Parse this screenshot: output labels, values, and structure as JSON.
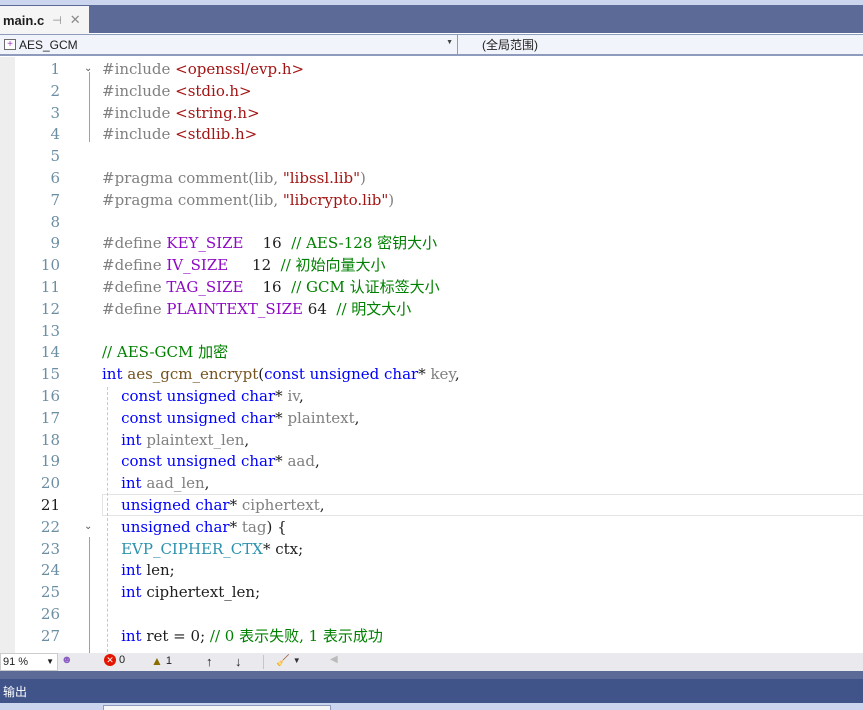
{
  "tab": {
    "title": "main.c",
    "pin_icon": "pin-icon",
    "close_icon": "close-icon"
  },
  "navbar": {
    "scope_left": "AES_GCM",
    "scope_right": "(全局范围)"
  },
  "editor": {
    "current_line": 21,
    "lines": [
      {
        "n": "1",
        "tokens": [
          [
            "k-pre",
            "#include "
          ],
          [
            "k-inc",
            "<openssl/evp.h>"
          ]
        ]
      },
      {
        "n": "2",
        "tokens": [
          [
            "k-pre",
            "#include "
          ],
          [
            "k-inc",
            "<stdio.h>"
          ]
        ]
      },
      {
        "n": "3",
        "tokens": [
          [
            "k-pre",
            "#include "
          ],
          [
            "k-inc",
            "<string.h>"
          ]
        ]
      },
      {
        "n": "4",
        "tokens": [
          [
            "k-pre",
            "#include "
          ],
          [
            "k-inc",
            "<stdlib.h>"
          ]
        ]
      },
      {
        "n": "5",
        "tokens": []
      },
      {
        "n": "6",
        "tokens": [
          [
            "k-pre",
            "#pragma comment(lib, "
          ],
          [
            "k-inc",
            "\"libssl.lib\""
          ],
          [
            "k-pre",
            ")"
          ]
        ]
      },
      {
        "n": "7",
        "tokens": [
          [
            "k-pre",
            "#pragma comment(lib, "
          ],
          [
            "k-inc",
            "\"libcrypto.lib\""
          ],
          [
            "k-pre",
            ")"
          ]
        ]
      },
      {
        "n": "8",
        "tokens": []
      },
      {
        "n": "9",
        "tokens": [
          [
            "k-pre",
            "#define "
          ],
          [
            "k-mac",
            "KEY_SIZE"
          ],
          [
            "k-num",
            "    16  "
          ],
          [
            "k-cmt",
            "// AES-128 密钥大小"
          ]
        ]
      },
      {
        "n": "10",
        "tokens": [
          [
            "k-pre",
            "#define "
          ],
          [
            "k-mac",
            "IV_SIZE"
          ],
          [
            "k-num",
            "     12  "
          ],
          [
            "k-cmt",
            "// 初始向量大小"
          ]
        ]
      },
      {
        "n": "11",
        "tokens": [
          [
            "k-pre",
            "#define "
          ],
          [
            "k-mac",
            "TAG_SIZE"
          ],
          [
            "k-num",
            "    16  "
          ],
          [
            "k-cmt",
            "// GCM 认证标签大小"
          ]
        ]
      },
      {
        "n": "12",
        "tokens": [
          [
            "k-pre",
            "#define "
          ],
          [
            "k-mac",
            "PLAINTEXT_SIZE"
          ],
          [
            "k-num",
            " 64  "
          ],
          [
            "k-cmt",
            "// 明文大小"
          ]
        ]
      },
      {
        "n": "13",
        "tokens": []
      },
      {
        "n": "14",
        "tokens": [
          [
            "k-cmt",
            "// AES-GCM 加密"
          ]
        ]
      },
      {
        "n": "15",
        "tokens": [
          [
            "k-key",
            "int "
          ],
          [
            "k-fn",
            "aes_gcm_encrypt"
          ],
          [
            "k-txt",
            "("
          ],
          [
            "k-key",
            "const unsigned char"
          ],
          [
            "k-txt",
            "* "
          ],
          [
            "k-par",
            "key"
          ],
          [
            "k-txt",
            ","
          ]
        ]
      },
      {
        "n": "16",
        "tokens": [
          [
            "k-txt",
            "    "
          ],
          [
            "k-key",
            "const unsigned char"
          ],
          [
            "k-txt",
            "* "
          ],
          [
            "k-par",
            "iv"
          ],
          [
            "k-txt",
            ","
          ]
        ]
      },
      {
        "n": "17",
        "tokens": [
          [
            "k-txt",
            "    "
          ],
          [
            "k-key",
            "const unsigned char"
          ],
          [
            "k-txt",
            "* "
          ],
          [
            "k-par",
            "plaintext"
          ],
          [
            "k-txt",
            ","
          ]
        ]
      },
      {
        "n": "18",
        "tokens": [
          [
            "k-txt",
            "    "
          ],
          [
            "k-key",
            "int "
          ],
          [
            "k-par",
            "plaintext_len"
          ],
          [
            "k-txt",
            ","
          ]
        ]
      },
      {
        "n": "19",
        "tokens": [
          [
            "k-txt",
            "    "
          ],
          [
            "k-key",
            "const unsigned char"
          ],
          [
            "k-txt",
            "* "
          ],
          [
            "k-par",
            "aad"
          ],
          [
            "k-txt",
            ","
          ]
        ]
      },
      {
        "n": "20",
        "tokens": [
          [
            "k-txt",
            "    "
          ],
          [
            "k-key",
            "int "
          ],
          [
            "k-par",
            "aad_len"
          ],
          [
            "k-txt",
            ","
          ]
        ]
      },
      {
        "n": "21",
        "tokens": [
          [
            "k-txt",
            "    "
          ],
          [
            "k-key",
            "unsigned char"
          ],
          [
            "k-txt",
            "* "
          ],
          [
            "k-par",
            "ciphertext"
          ],
          [
            "k-txt",
            ","
          ]
        ]
      },
      {
        "n": "22",
        "tokens": [
          [
            "k-txt",
            "    "
          ],
          [
            "k-key",
            "unsigned char"
          ],
          [
            "k-txt",
            "* "
          ],
          [
            "k-par",
            "tag"
          ],
          [
            "k-txt",
            ") {"
          ]
        ]
      },
      {
        "n": "23",
        "tokens": [
          [
            "k-txt",
            "    "
          ],
          [
            "k-typ",
            "EVP_CIPHER_CTX"
          ],
          [
            "k-txt",
            "* ctx;"
          ]
        ]
      },
      {
        "n": "24",
        "tokens": [
          [
            "k-txt",
            "    "
          ],
          [
            "k-key",
            "int "
          ],
          [
            "k-txt",
            "len;"
          ]
        ]
      },
      {
        "n": "25",
        "tokens": [
          [
            "k-txt",
            "    "
          ],
          [
            "k-key",
            "int "
          ],
          [
            "k-txt",
            "ciphertext_len;"
          ]
        ]
      },
      {
        "n": "26",
        "tokens": []
      },
      {
        "n": "27",
        "tokens": [
          [
            "k-txt",
            "    "
          ],
          [
            "k-key",
            "int "
          ],
          [
            "k-txt",
            "ret = 0; "
          ],
          [
            "k-cmt",
            "// 0 表示失败, 1 表示成功"
          ]
        ]
      }
    ]
  },
  "status": {
    "zoom": "91 %",
    "errors": "0",
    "warnings": "1",
    "up_arrow": "↑",
    "down_arrow": "↓"
  },
  "output_panel": {
    "title": "输出"
  }
}
